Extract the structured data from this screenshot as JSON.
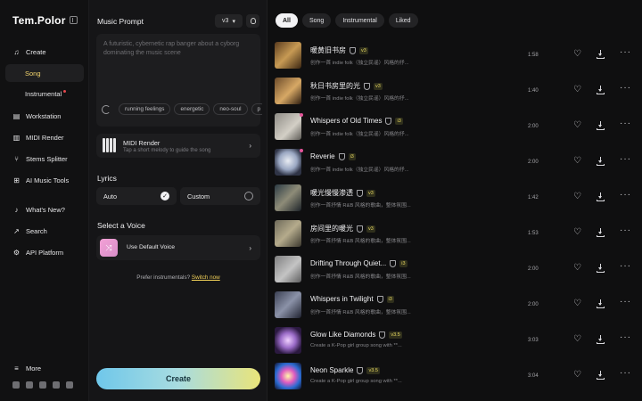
{
  "sidebar": {
    "logo": "Tem.Polor",
    "items": [
      {
        "label": "Create",
        "icon": "music-note-icon"
      },
      {
        "label": "Song",
        "active": true
      },
      {
        "label": "Instrumental",
        "dot": true
      },
      {
        "label": "Workstation",
        "icon": "stack-icon"
      },
      {
        "label": "MIDI Render",
        "icon": "piano-icon"
      },
      {
        "label": "Stems Splitter",
        "icon": "split-icon"
      },
      {
        "label": "AI Music Tools",
        "icon": "plus-box-icon"
      },
      {
        "label": "What's New?",
        "icon": "bell-icon"
      },
      {
        "label": "Search",
        "icon": "arrow-icon"
      },
      {
        "label": "API Platform",
        "icon": "api-icon"
      },
      {
        "label": "More",
        "icon": "menu-icon"
      }
    ]
  },
  "panel": {
    "music_prompt_title": "Music Prompt",
    "version": "v3",
    "prompt_placeholder": "A futuristic, cybernetic rap banger about a cyborg dominating the music scene",
    "tags": [
      "running feelings",
      "energetic",
      "neo-soul",
      "p"
    ],
    "midi_title": "MIDI Render",
    "midi_sub": "Tap a short melody to guide the song",
    "lyrics_title": "Lyrics",
    "lyrics_auto": "Auto",
    "lyrics_custom": "Custom",
    "voice_title": "Select a Voice",
    "voice_default": "Use Default Voice",
    "hint_text": "Prefer instrumentals?",
    "hint_link": "Switch now",
    "create_label": "Create"
  },
  "filters": [
    "All",
    "Song",
    "Instrumental",
    "Liked"
  ],
  "songs": [
    {
      "title": "暖黄旧书房",
      "version": "v3",
      "sub": "创作一首 indie folk（独立民谣）风格的抒...",
      "duration": "1:58"
    },
    {
      "title": "秋日书房里的光",
      "version": "v3",
      "sub": "创作一首 indie folk（独立民谣）风格的抒...",
      "duration": "1:40"
    },
    {
      "title": "Whispers of Old Times",
      "version": "i3",
      "sub": "创作一首 indie folk（独立民谣）风格的抒...",
      "duration": "2:00"
    },
    {
      "title": "Reverie",
      "version": "i3",
      "sub": "创作一首 indie folk（独立民谣）风格的抒...",
      "duration": "2:00"
    },
    {
      "title": "暖光慢慢渗透",
      "version": "v3",
      "sub": "创作一首抒情 R&B 风格的歌曲，整体氛围...",
      "duration": "1:42"
    },
    {
      "title": "房间里的暖光",
      "version": "v3",
      "sub": "创作一首抒情 R&B 风格的歌曲，整体氛围...",
      "duration": "1:53"
    },
    {
      "title": "Drifting Through Quiet...",
      "version": "i3",
      "sub": "创作一首抒情 R&B 风格的歌曲，整体氛围...",
      "duration": "2:00"
    },
    {
      "title": "Whispers in Twilight",
      "version": "i3",
      "sub": "创作一首抒情 R&B 风格的歌曲，整体氛围...",
      "duration": "2:00"
    },
    {
      "title": "Glow Like Diamonds",
      "version": "v3.5",
      "sub": "Create a K-Pop girl group song with **...",
      "duration": "3:03"
    },
    {
      "title": "Neon Sparkle",
      "version": "v3.5",
      "sub": "Create a K-Pop girl group song with **...",
      "duration": "3:04"
    }
  ],
  "colors": {
    "accent": "#f1d36c",
    "badge": "#e8d760",
    "new_dot": "#e5559a"
  }
}
